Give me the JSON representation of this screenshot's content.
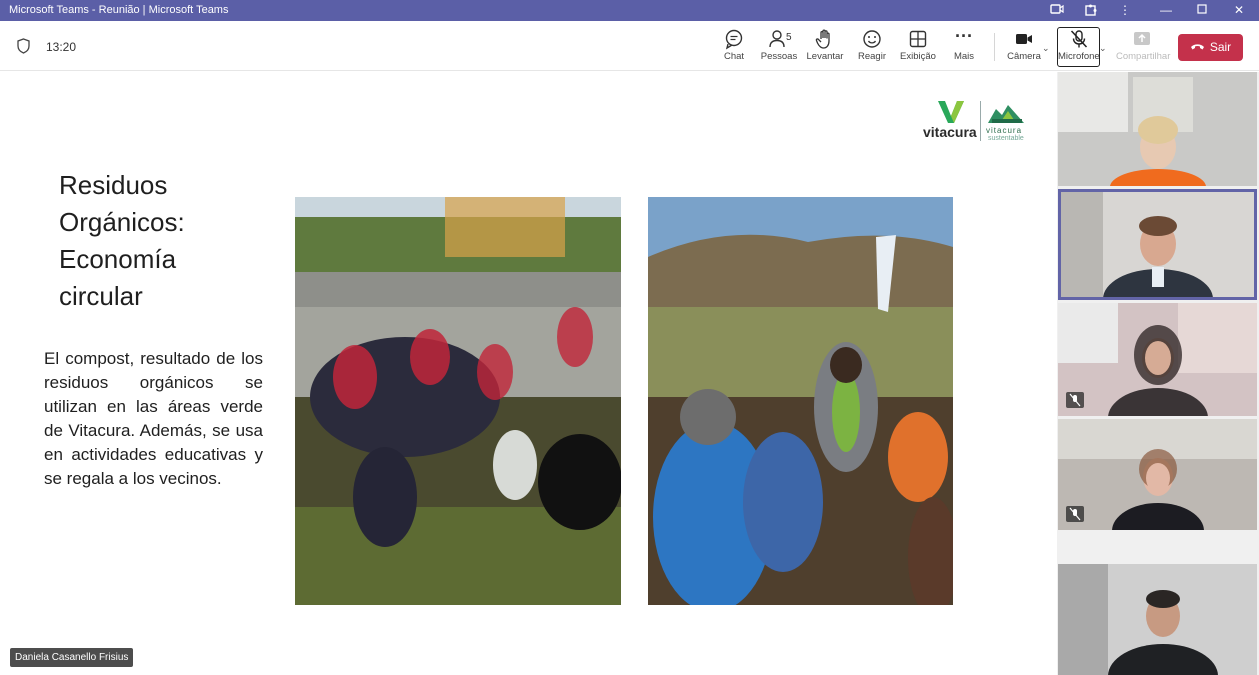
{
  "window": {
    "title": "Microsoft Teams - Reunião | Microsoft Teams"
  },
  "meeting": {
    "time": "13:20",
    "participants_count": "5"
  },
  "toolbar": {
    "chat": "Chat",
    "people": "Pessoas",
    "raise": "Levantar",
    "react": "Reagir",
    "view": "Exibição",
    "more": "Mais",
    "camera": "Câmera",
    "mic": "Microfone",
    "share": "Compartilhar",
    "leave": "Sair"
  },
  "slide": {
    "title": "Residuos Orgánicos: Economía circular",
    "body": "El compost, resultado de los residuos orgánicos se utilizan en las áreas verde de Vitacura. Además, se usa en actividades educativas y se regala a los vecinos.",
    "logo_name": "vitacura",
    "logo_sub1": "vitacura",
    "logo_sub2": "sustentable"
  },
  "presenter": {
    "name": "Daniela Casanello Frisius"
  },
  "colors": {
    "teams_purple": "#5b5fa7",
    "leave_red": "#c4314b",
    "active_tile": "#6264a7"
  }
}
